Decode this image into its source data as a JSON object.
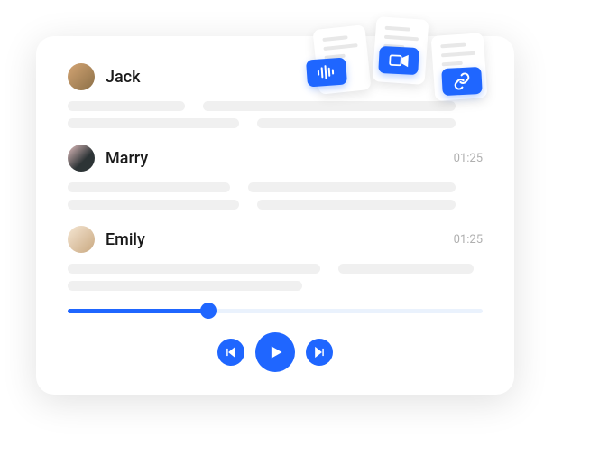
{
  "entries": [
    {
      "name": "Jack",
      "timestamp": ""
    },
    {
      "name": "Marry",
      "timestamp": "01:25"
    },
    {
      "name": "Emily",
      "timestamp": "01:25"
    }
  ],
  "progress": {
    "percent": 34
  },
  "media_badges": [
    "audio",
    "video",
    "link"
  ]
}
